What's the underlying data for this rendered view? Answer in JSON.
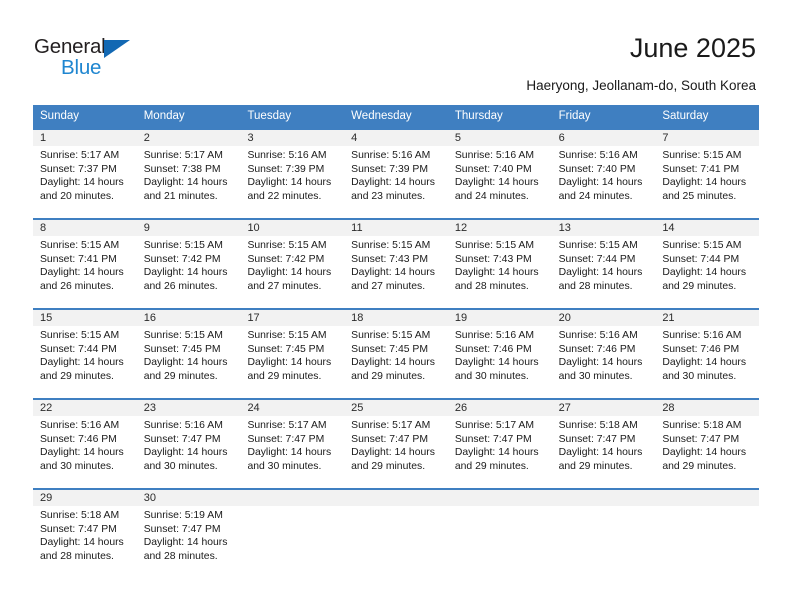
{
  "brand": {
    "name_part1": "General",
    "name_part2": "Blue"
  },
  "header": {
    "title": "June 2025",
    "subtitle": "Haeryong, Jeollanam-do, South Korea"
  },
  "colors": {
    "header_blue": "#3f7fc1",
    "logo_dark": "#231f20",
    "logo_blue": "#1f86d0",
    "daynum_band": "#f2f2f2"
  },
  "weekdays": [
    "Sunday",
    "Monday",
    "Tuesday",
    "Wednesday",
    "Thursday",
    "Friday",
    "Saturday"
  ],
  "weeks": [
    [
      {
        "day": "1",
        "sunrise": "Sunrise: 5:17 AM",
        "sunset": "Sunset: 7:37 PM",
        "daylight1": "Daylight: 14 hours",
        "daylight2": "and 20 minutes."
      },
      {
        "day": "2",
        "sunrise": "Sunrise: 5:17 AM",
        "sunset": "Sunset: 7:38 PM",
        "daylight1": "Daylight: 14 hours",
        "daylight2": "and 21 minutes."
      },
      {
        "day": "3",
        "sunrise": "Sunrise: 5:16 AM",
        "sunset": "Sunset: 7:39 PM",
        "daylight1": "Daylight: 14 hours",
        "daylight2": "and 22 minutes."
      },
      {
        "day": "4",
        "sunrise": "Sunrise: 5:16 AM",
        "sunset": "Sunset: 7:39 PM",
        "daylight1": "Daylight: 14 hours",
        "daylight2": "and 23 minutes."
      },
      {
        "day": "5",
        "sunrise": "Sunrise: 5:16 AM",
        "sunset": "Sunset: 7:40 PM",
        "daylight1": "Daylight: 14 hours",
        "daylight2": "and 24 minutes."
      },
      {
        "day": "6",
        "sunrise": "Sunrise: 5:16 AM",
        "sunset": "Sunset: 7:40 PM",
        "daylight1": "Daylight: 14 hours",
        "daylight2": "and 24 minutes."
      },
      {
        "day": "7",
        "sunrise": "Sunrise: 5:15 AM",
        "sunset": "Sunset: 7:41 PM",
        "daylight1": "Daylight: 14 hours",
        "daylight2": "and 25 minutes."
      }
    ],
    [
      {
        "day": "8",
        "sunrise": "Sunrise: 5:15 AM",
        "sunset": "Sunset: 7:41 PM",
        "daylight1": "Daylight: 14 hours",
        "daylight2": "and 26 minutes."
      },
      {
        "day": "9",
        "sunrise": "Sunrise: 5:15 AM",
        "sunset": "Sunset: 7:42 PM",
        "daylight1": "Daylight: 14 hours",
        "daylight2": "and 26 minutes."
      },
      {
        "day": "10",
        "sunrise": "Sunrise: 5:15 AM",
        "sunset": "Sunset: 7:42 PM",
        "daylight1": "Daylight: 14 hours",
        "daylight2": "and 27 minutes."
      },
      {
        "day": "11",
        "sunrise": "Sunrise: 5:15 AM",
        "sunset": "Sunset: 7:43 PM",
        "daylight1": "Daylight: 14 hours",
        "daylight2": "and 27 minutes."
      },
      {
        "day": "12",
        "sunrise": "Sunrise: 5:15 AM",
        "sunset": "Sunset: 7:43 PM",
        "daylight1": "Daylight: 14 hours",
        "daylight2": "and 28 minutes."
      },
      {
        "day": "13",
        "sunrise": "Sunrise: 5:15 AM",
        "sunset": "Sunset: 7:44 PM",
        "daylight1": "Daylight: 14 hours",
        "daylight2": "and 28 minutes."
      },
      {
        "day": "14",
        "sunrise": "Sunrise: 5:15 AM",
        "sunset": "Sunset: 7:44 PM",
        "daylight1": "Daylight: 14 hours",
        "daylight2": "and 29 minutes."
      }
    ],
    [
      {
        "day": "15",
        "sunrise": "Sunrise: 5:15 AM",
        "sunset": "Sunset: 7:44 PM",
        "daylight1": "Daylight: 14 hours",
        "daylight2": "and 29 minutes."
      },
      {
        "day": "16",
        "sunrise": "Sunrise: 5:15 AM",
        "sunset": "Sunset: 7:45 PM",
        "daylight1": "Daylight: 14 hours",
        "daylight2": "and 29 minutes."
      },
      {
        "day": "17",
        "sunrise": "Sunrise: 5:15 AM",
        "sunset": "Sunset: 7:45 PM",
        "daylight1": "Daylight: 14 hours",
        "daylight2": "and 29 minutes."
      },
      {
        "day": "18",
        "sunrise": "Sunrise: 5:15 AM",
        "sunset": "Sunset: 7:45 PM",
        "daylight1": "Daylight: 14 hours",
        "daylight2": "and 29 minutes."
      },
      {
        "day": "19",
        "sunrise": "Sunrise: 5:16 AM",
        "sunset": "Sunset: 7:46 PM",
        "daylight1": "Daylight: 14 hours",
        "daylight2": "and 30 minutes."
      },
      {
        "day": "20",
        "sunrise": "Sunrise: 5:16 AM",
        "sunset": "Sunset: 7:46 PM",
        "daylight1": "Daylight: 14 hours",
        "daylight2": "and 30 minutes."
      },
      {
        "day": "21",
        "sunrise": "Sunrise: 5:16 AM",
        "sunset": "Sunset: 7:46 PM",
        "daylight1": "Daylight: 14 hours",
        "daylight2": "and 30 minutes."
      }
    ],
    [
      {
        "day": "22",
        "sunrise": "Sunrise: 5:16 AM",
        "sunset": "Sunset: 7:46 PM",
        "daylight1": "Daylight: 14 hours",
        "daylight2": "and 30 minutes."
      },
      {
        "day": "23",
        "sunrise": "Sunrise: 5:16 AM",
        "sunset": "Sunset: 7:47 PM",
        "daylight1": "Daylight: 14 hours",
        "daylight2": "and 30 minutes."
      },
      {
        "day": "24",
        "sunrise": "Sunrise: 5:17 AM",
        "sunset": "Sunset: 7:47 PM",
        "daylight1": "Daylight: 14 hours",
        "daylight2": "and 30 minutes."
      },
      {
        "day": "25",
        "sunrise": "Sunrise: 5:17 AM",
        "sunset": "Sunset: 7:47 PM",
        "daylight1": "Daylight: 14 hours",
        "daylight2": "and 29 minutes."
      },
      {
        "day": "26",
        "sunrise": "Sunrise: 5:17 AM",
        "sunset": "Sunset: 7:47 PM",
        "daylight1": "Daylight: 14 hours",
        "daylight2": "and 29 minutes."
      },
      {
        "day": "27",
        "sunrise": "Sunrise: 5:18 AM",
        "sunset": "Sunset: 7:47 PM",
        "daylight1": "Daylight: 14 hours",
        "daylight2": "and 29 minutes."
      },
      {
        "day": "28",
        "sunrise": "Sunrise: 5:18 AM",
        "sunset": "Sunset: 7:47 PM",
        "daylight1": "Daylight: 14 hours",
        "daylight2": "and 29 minutes."
      }
    ],
    [
      {
        "day": "29",
        "sunrise": "Sunrise: 5:18 AM",
        "sunset": "Sunset: 7:47 PM",
        "daylight1": "Daylight: 14 hours",
        "daylight2": "and 28 minutes."
      },
      {
        "day": "30",
        "sunrise": "Sunrise: 5:19 AM",
        "sunset": "Sunset: 7:47 PM",
        "daylight1": "Daylight: 14 hours",
        "daylight2": "and 28 minutes."
      },
      {
        "day": "",
        "sunrise": "",
        "sunset": "",
        "daylight1": "",
        "daylight2": ""
      },
      {
        "day": "",
        "sunrise": "",
        "sunset": "",
        "daylight1": "",
        "daylight2": ""
      },
      {
        "day": "",
        "sunrise": "",
        "sunset": "",
        "daylight1": "",
        "daylight2": ""
      },
      {
        "day": "",
        "sunrise": "",
        "sunset": "",
        "daylight1": "",
        "daylight2": ""
      },
      {
        "day": "",
        "sunrise": "",
        "sunset": "",
        "daylight1": "",
        "daylight2": ""
      }
    ]
  ]
}
